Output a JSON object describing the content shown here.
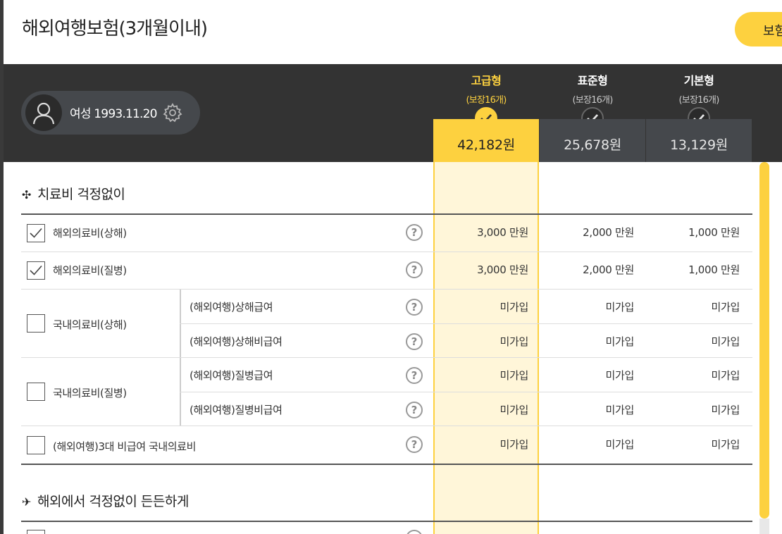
{
  "page": {
    "title": "해외여행보험(3개월이내)",
    "top_button": "보험"
  },
  "profile": {
    "text": "여성 1993.11.20"
  },
  "plans": [
    {
      "name": "고급형",
      "coverage": "(보장16개)",
      "price": "42,182원",
      "active": true
    },
    {
      "name": "표준형",
      "coverage": "(보장16개)",
      "price": "25,678원",
      "active": false
    },
    {
      "name": "기본형",
      "coverage": "(보장16개)",
      "price": "13,129원",
      "active": false
    }
  ],
  "sections": [
    {
      "icon": "✣",
      "title": "치료비 걱정없이"
    },
    {
      "icon": "✈",
      "title": "해외에서 걱정없이 든든하게"
    }
  ],
  "rows": [
    {
      "label": "해외의료비(상해)",
      "checked": true,
      "values": [
        "3,000 만원",
        "2,000 만원",
        "1,000 만원"
      ]
    },
    {
      "label": "해외의료비(질병)",
      "checked": true,
      "values": [
        "3,000 만원",
        "2,000 만원",
        "1,000 만원"
      ]
    },
    {
      "label": "국내의료비(상해)",
      "checked": false,
      "subs": [
        {
          "label": "(해외여행)상해급여",
          "values": [
            "미가입",
            "미가입",
            "미가입"
          ]
        },
        {
          "label": "(해외여행)상해비급여",
          "values": [
            "미가입",
            "미가입",
            "미가입"
          ]
        }
      ]
    },
    {
      "label": "국내의료비(질병)",
      "checked": false,
      "subs": [
        {
          "label": "(해외여행)질병급여",
          "values": [
            "미가입",
            "미가입",
            "미가입"
          ]
        },
        {
          "label": "(해외여행)질병비급여",
          "values": [
            "미가입",
            "미가입",
            "미가입"
          ]
        }
      ]
    },
    {
      "label": "(해외여행)3대 비급여 국내의료비",
      "checked": false,
      "values": [
        "미가입",
        "미가입",
        "미가입"
      ]
    }
  ],
  "help_mark": "?"
}
